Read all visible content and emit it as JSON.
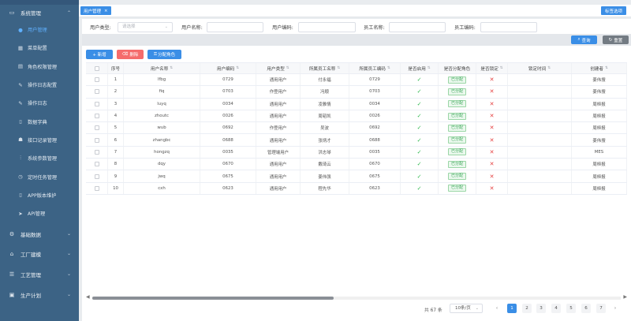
{
  "sidebar": {
    "groups": [
      {
        "label": "系统管理",
        "icon": "monitor-icon"
      },
      {
        "label": "基础数据",
        "icon": "settings-icon"
      },
      {
        "label": "工厂建模",
        "icon": "factory-icon"
      },
      {
        "label": "工艺管理",
        "icon": "menu-icon"
      },
      {
        "label": "生产计划",
        "icon": "calendar-icon"
      }
    ],
    "items": [
      {
        "label": "用户管理",
        "icon": "user-icon"
      },
      {
        "label": "菜单配置",
        "icon": "grid-icon"
      },
      {
        "label": "角色权限管理",
        "icon": "document-icon"
      },
      {
        "label": "操作日志配置",
        "icon": "edit-icon"
      },
      {
        "label": "操作日志",
        "icon": "edit-icon"
      },
      {
        "label": "数据字典",
        "icon": "book-icon"
      },
      {
        "label": "接口记录管理",
        "icon": "users-icon"
      },
      {
        "label": "系统参数管理",
        "icon": "sliders-icon"
      },
      {
        "label": "定时任务管理",
        "icon": "clock-icon"
      },
      {
        "label": "APP版本维护",
        "icon": "tablet-icon"
      },
      {
        "label": "API管理",
        "icon": "send-icon"
      }
    ]
  },
  "tabs": {
    "active_tab": "用户管理",
    "options_label": "标签选项"
  },
  "filters": {
    "user_type_label": "用户类型:",
    "user_type_placeholder": "请选择",
    "user_name_label": "用户名称:",
    "user_code_label": "用户编码:",
    "employee_name_label": "员工名称:",
    "employee_code_label": "员工编码:"
  },
  "search": {
    "query_label": "查询",
    "reset_label": "重置"
  },
  "actions": {
    "add_label": "+ 新增",
    "delete_label": "删除",
    "assign_role_label": "分配角色"
  },
  "table": {
    "headers": [
      "序号",
      "用户名称",
      "用户编码",
      "用户类型",
      "所属员工名称",
      "所属员工编码",
      "是否启用",
      "是否分配角色",
      "是否锁定",
      "锁定时间",
      "创建者"
    ],
    "rows": [
      {
        "no": "1",
        "name": "lfbg",
        "code": "0729",
        "type": "通用用户",
        "emp_name": "付永福",
        "emp_code": "0729",
        "role": "已分配",
        "creator": "姜伟搜"
      },
      {
        "no": "2",
        "name": "fiq",
        "code": "0703",
        "type": "作登用户",
        "emp_name": "冯顺",
        "emp_code": "0703",
        "role": "已分配",
        "creator": "姜伟搜"
      },
      {
        "no": "3",
        "name": "luyq",
        "code": "0034",
        "type": "通用用户",
        "emp_name": "凌雅情",
        "emp_code": "0034",
        "role": "已分配",
        "creator": "周桓报"
      },
      {
        "no": "4",
        "name": "zhoutc",
        "code": "0026",
        "type": "通用用户",
        "emp_name": "周韬凯",
        "emp_code": "0026",
        "role": "已分配",
        "creator": "周桓报"
      },
      {
        "no": "5",
        "name": "wub",
        "code": "0692",
        "type": "作登用户",
        "emp_name": "吴波",
        "emp_code": "0692",
        "role": "已分配",
        "creator": "周桓报"
      },
      {
        "no": "6",
        "name": "zhangbc",
        "code": "0688",
        "type": "通用用户",
        "emp_name": "张炳才",
        "emp_code": "0688",
        "role": "已分配",
        "creator": "姜伟搜"
      },
      {
        "no": "7",
        "name": "hongzq",
        "code": "0035",
        "type": "管理端用户",
        "emp_name": "洪志琴",
        "emp_code": "0035",
        "role": "已分配",
        "creator": "MES"
      },
      {
        "no": "8",
        "name": "dqy",
        "code": "0670",
        "type": "通用用户",
        "emp_name": "戴琦云",
        "emp_code": "0670",
        "role": "已分配",
        "creator": "周桓报"
      },
      {
        "no": "9",
        "name": "jwq",
        "code": "0675",
        "type": "通用用户",
        "emp_name": "姜伟强",
        "emp_code": "0675",
        "role": "已分配",
        "creator": "周桓报"
      },
      {
        "no": "10",
        "name": "cxh",
        "code": "0623",
        "type": "通用用户",
        "emp_name": "程先华",
        "emp_code": "0623",
        "role": "已分配",
        "creator": "周桓报"
      }
    ],
    "enabled_mark": "✓",
    "locked_mark": "✕"
  },
  "pagination": {
    "total": "共 67 条",
    "page_size": "10条/页",
    "pages": [
      "1",
      "2",
      "3",
      "4",
      "5",
      "6",
      "7"
    ],
    "current_page": "1",
    "prev": "‹",
    "next": "›"
  },
  "colors": {
    "sidebar_bg": "#3c6385",
    "primary": "#3a8ee6",
    "danger": "#f56c6c",
    "success": "#2db84d"
  }
}
